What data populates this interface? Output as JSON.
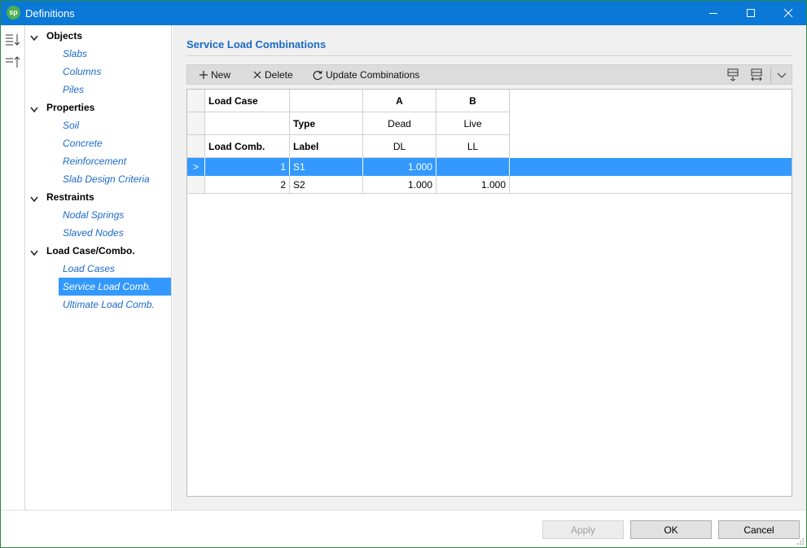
{
  "window": {
    "title": "Definitions",
    "logo_text": "sp",
    "minimize_icon": "minimize-icon",
    "maximize_icon": "maximize-icon",
    "close_icon": "close-icon"
  },
  "sidebar_icons": [
    "sort-descending-icon",
    "sort-ascending-icon"
  ],
  "tree": {
    "groups": [
      {
        "label": "Objects",
        "items": [
          "Slabs",
          "Columns",
          "Piles"
        ]
      },
      {
        "label": "Properties",
        "items": [
          "Soil",
          "Concrete",
          "Reinforcement",
          "Slab Design Criteria"
        ]
      },
      {
        "label": "Restraints",
        "items": [
          "Nodal Springs",
          "Slaved Nodes"
        ]
      },
      {
        "label": "Load Case/Combo.",
        "items": [
          "Load Cases",
          "Service Load Comb.",
          "Ultimate Load Comb."
        ]
      }
    ],
    "selected": "Service Load Comb."
  },
  "main": {
    "section_title": "Service Load Combinations",
    "toolbar": {
      "new_label": "New",
      "delete_label": "Delete",
      "update_label": "Update Combinations"
    },
    "grid": {
      "header_row1": {
        "col1": "Load Case",
        "col2": "",
        "colA": "A",
        "colB": "B"
      },
      "header_row2": {
        "col1": "",
        "col2": "Type",
        "colA": "Dead",
        "colB": "Live"
      },
      "header_row3": {
        "col1": "Load Comb.",
        "col2": "Label",
        "colA": "DL",
        "colB": "LL"
      },
      "rows": [
        {
          "indicator": ">",
          "num": "1",
          "label": "S1",
          "a": "1.000",
          "b": ""
        },
        {
          "indicator": "",
          "num": "2",
          "label": "S2",
          "a": "1.000",
          "b": "1.000"
        }
      ],
      "selected_row": 0
    }
  },
  "footer": {
    "apply_label": "Apply",
    "ok_label": "OK",
    "cancel_label": "Cancel"
  },
  "colors": {
    "titlebar": "#0a78d7",
    "accent_text": "#1b6ac9",
    "selection": "#3399ff",
    "window_border": "#2b8a3e"
  }
}
